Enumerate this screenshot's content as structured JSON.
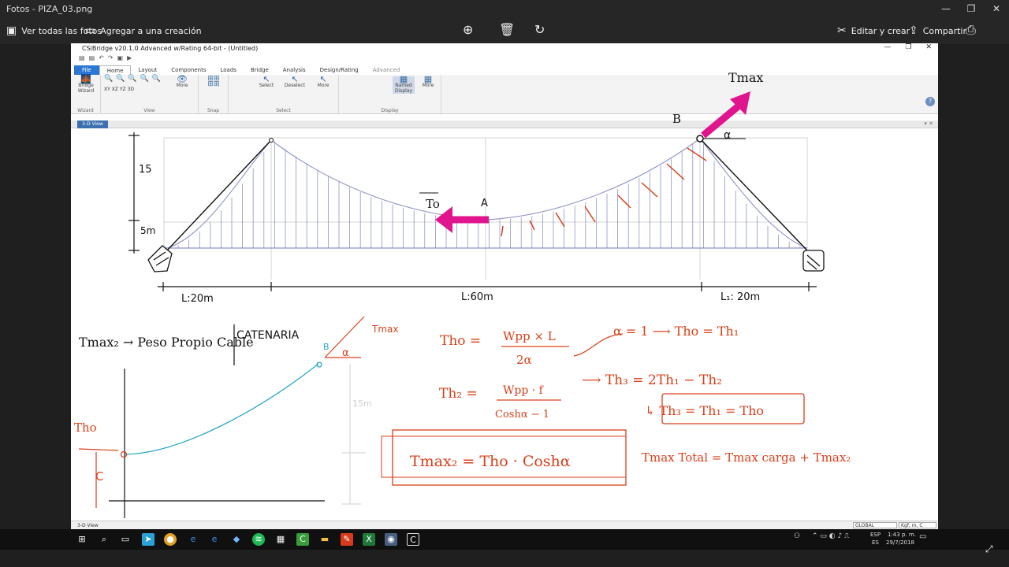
{
  "window": {
    "title": "Fotos - PIZA_03.png"
  },
  "toolbar": {
    "see_all": "Ver todas las fotos",
    "add_to_creation": "Agregar a una creación",
    "edit_create": "Editar y crear",
    "share": "Compartir"
  },
  "app": {
    "title": "CSiBridge v20.1.0 Advanced w/Rating 64-bit - (Untitled)",
    "tabs": [
      "File",
      "Home",
      "Layout",
      "Components",
      "Loads",
      "Bridge",
      "Analysis",
      "Design/Rating",
      "Advanced"
    ],
    "ribbon": {
      "bridge_wizard": "Bridge Wizard",
      "wizard_group": "Wizard",
      "view_group": "View",
      "more": "More",
      "snap_group": "Snap",
      "select": "Select",
      "deselect": "Deselect",
      "select_group": "Select",
      "named_display": "Named Display",
      "display_group": "Display",
      "view_icons": [
        "XY",
        "XZ",
        "YZ",
        "3D"
      ]
    },
    "view_tab": "3-D View",
    "status": {
      "left": "3-D View",
      "coord": "GLOBAL",
      "units": "Kgf, m, C"
    }
  },
  "annotations": {
    "tmax_top": "Tmax",
    "point_b": "B",
    "alpha_top": "α",
    "point_a": "A",
    "tho": "To",
    "dim_15": "15",
    "dim_5m": "5m",
    "span_left": "L:20m",
    "span_mid": "L:60m",
    "span_right": "L₁: 20m",
    "eq_tmax2": "Tmax₂ → Peso Propio Cable",
    "catenaria": "CATENARIA",
    "small_b": "B",
    "small_tmax": "Tmax",
    "small_alpha": "α",
    "small_15m": "15m",
    "tho_small": "Tho",
    "c_label": "C",
    "eq1_lhs": "Tho =",
    "eq1_num": "Wpp × L",
    "eq1_den": "2α",
    "eq1_rhs": "α = 1 ⟶ Tho = Th₁",
    "eq2_lhs": "Th₂ =",
    "eq2_num": "Wpp · f",
    "eq2_den": "Coshα − 1",
    "eq3": "⟶ Th₃ = 2Th₁ − Th₂",
    "eq4": "↳ Th₃ = Th₁ = Tho",
    "eq_box": "Tmax₂ = Tho · Coshα",
    "eq_total": "Tmax Total = Tmax carga + Tmax₂"
  },
  "taskbar": {
    "lang": "ESP",
    "region": "ES",
    "time": "1:43 p. m.",
    "date": "29/7/2018"
  },
  "colors": {
    "annotation_red": "#d9401a",
    "magenta": "#e0148c",
    "cable_blue": "#8e95c8",
    "curve_cyan": "#2aa9c8"
  }
}
